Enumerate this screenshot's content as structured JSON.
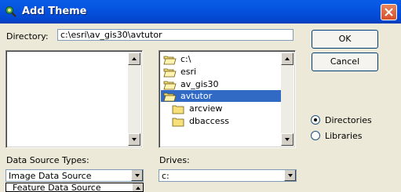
{
  "window": {
    "title": "Add Theme",
    "close_icon": "close-icon"
  },
  "directory": {
    "label": "Directory:",
    "value": "c:\\esri\\av_gis30\\avtutor"
  },
  "buttons": {
    "ok": "OK",
    "cancel": "Cancel"
  },
  "tree": [
    {
      "label": "c:\\",
      "icon": "open-folder-icon",
      "selected": false
    },
    {
      "label": "esri",
      "icon": "open-folder-icon",
      "selected": false
    },
    {
      "label": "av_gis30",
      "icon": "open-folder-icon",
      "selected": false
    },
    {
      "label": "avtutor",
      "icon": "open-folder-icon",
      "selected": true
    },
    {
      "label": "arcview",
      "icon": "folder-icon",
      "selected": false
    },
    {
      "label": "dbaccess",
      "icon": "folder-icon",
      "selected": false
    }
  ],
  "options": {
    "directories": {
      "label": "Directories",
      "checked": true
    },
    "libraries": {
      "label": "Libraries",
      "checked": false
    }
  },
  "data_source": {
    "label": "Data Source Types:",
    "value": "Image Data Source",
    "partial_option": "Feature Data Source"
  },
  "drives": {
    "label": "Drives:",
    "value": "c:"
  },
  "colors": {
    "title_bar": "#0554e0",
    "selection": "#316ac5",
    "dialog_bg": "#ece9d8"
  }
}
